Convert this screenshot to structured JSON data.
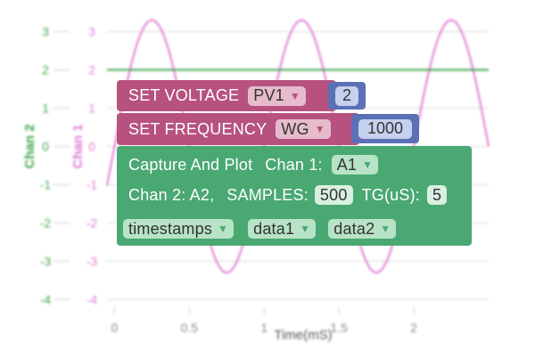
{
  "chart_data": {
    "type": "line",
    "xlabel": "Time(mS)",
    "ylabel_left": "Chan 2",
    "ylabel_right": "Chan 1",
    "xlim": [
      -0.05,
      2.5
    ],
    "ylim": [
      -4.2,
      3.5
    ],
    "x_ticks": [
      "0",
      "0.5",
      "1",
      "1.5",
      "2"
    ],
    "y_ticks": [
      "3",
      "2",
      "1",
      "0",
      "-1",
      "-2",
      "-3",
      "-4"
    ],
    "series": [
      {
        "color": "#e07ad6",
        "amplitude": 3.3,
        "period_ms": 1.0,
        "phase_ms": 0.0
      },
      {
        "color": "#3fa74a",
        "constant": 2.0
      }
    ],
    "grid": true
  },
  "blocks": {
    "set_voltage": {
      "label": "SET VOLTAGE",
      "channel": "PV1",
      "value": "2"
    },
    "set_frequency": {
      "label": "SET FREQUENCY",
      "channel": "WG",
      "value": "1000"
    },
    "capture": {
      "label": "Capture And Plot",
      "chan1_label": "Chan 1:",
      "chan1_value": "A1",
      "chan2_label": "Chan 2: A2,",
      "samples_label": "SAMPLES:",
      "samples_value": "500",
      "tg_label": "TG(uS):",
      "tg_value": "5",
      "out_timestamps": "timestamps",
      "out_data1": "data1",
      "out_data2": "data2"
    }
  }
}
